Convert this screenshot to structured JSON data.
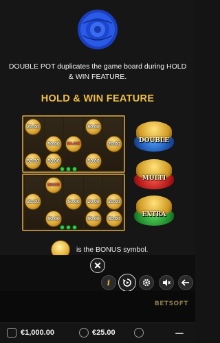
{
  "description": "DOUBLE POT duplicates the game board during HOLD & WIN FEATURE.",
  "feature_title": "HOLD & WIN FEATURE",
  "board1": {
    "coins": [
      "20.00",
      "80.00",
      "50.00",
      "MAJOR",
      "20.00",
      "50.00",
      "50.00",
      "50.00"
    ]
  },
  "board2": {
    "coins": [
      "MINOR",
      "20.00",
      "50.00",
      "20.00",
      "20.00",
      "50.00",
      "50.00",
      "80.00"
    ]
  },
  "pots": {
    "double": "DOUBLE",
    "multi": "MULTI",
    "extra": "EXTRA"
  },
  "bonus_text": "is the BONUS symbol.",
  "controls": {
    "close": "✕",
    "info": "i"
  },
  "brand": "BETSOFT",
  "footer": {
    "balance": "€1,000.00",
    "bet": "€25.00"
  },
  "colors": {
    "accent_gold": "#f0bf45",
    "dot_green": "#2fd04a",
    "rose_blue": "#1e4fd8"
  }
}
